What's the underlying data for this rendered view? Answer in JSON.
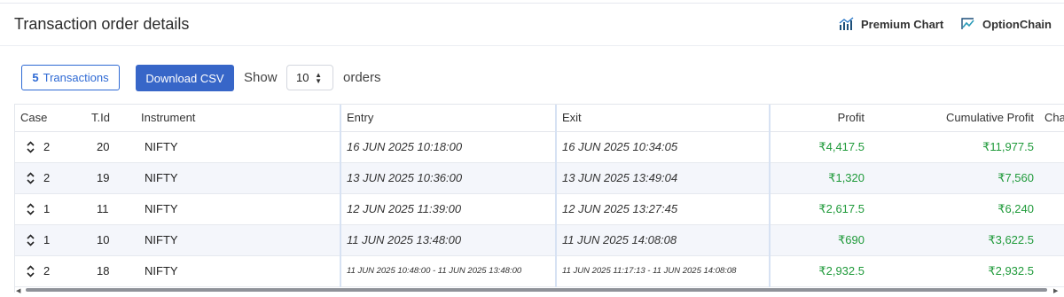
{
  "header": {
    "title": "Transaction order details",
    "premium_chart": "Premium Chart",
    "option_chain": "OptionChain"
  },
  "toolbar": {
    "count": "5",
    "count_label": "Transactions",
    "download_label": "Download CSV",
    "show_label": "Show",
    "page_size": "10",
    "orders_label": "orders"
  },
  "table": {
    "columns": {
      "case": "Case",
      "tid": "T.Id",
      "instrument": "Instrument",
      "entry": "Entry",
      "exit": "Exit",
      "profit": "Profit",
      "cumulative": "Cumulative Profit",
      "cha": "Cha"
    },
    "rows": [
      {
        "case": "2",
        "tid": "20",
        "instrument": "NIFTY",
        "entry": "16 JUN 2025 10:18:00",
        "exit": "16 JUN 2025 10:34:05",
        "profit": "₹4,417.5",
        "cumulative": "₹11,977.5"
      },
      {
        "case": "2",
        "tid": "19",
        "instrument": "NIFTY",
        "entry": "13 JUN 2025 10:36:00",
        "exit": "13 JUN 2025 13:49:04",
        "profit": "₹1,320",
        "cumulative": "₹7,560"
      },
      {
        "case": "1",
        "tid": "11",
        "instrument": "NIFTY",
        "entry": "12 JUN 2025 11:39:00",
        "exit": "12 JUN 2025 13:27:45",
        "profit": "₹2,617.5",
        "cumulative": "₹6,240"
      },
      {
        "case": "1",
        "tid": "10",
        "instrument": "NIFTY",
        "entry": "11 JUN 2025 13:48:00",
        "exit": "11 JUN 2025 14:08:08",
        "profit": "₹690",
        "cumulative": "₹3,622.5"
      },
      {
        "case": "2",
        "tid": "18",
        "instrument": "NIFTY",
        "entry": "11 JUN 2025 10:48:00 - 11 JUN 2025 13:48:00",
        "exit": "11 JUN 2025 11:17:13 - 11 JUN 2025 14:08:08",
        "profit": "₹2,932.5",
        "cumulative": "₹2,932.5"
      }
    ]
  },
  "colors": {
    "accent": "#3766c8",
    "profit_green": "#1f9a3a",
    "row_alt": "#f4f6fb"
  },
  "icons": [
    "premium-chart-icon",
    "option-chain-icon",
    "sort-icon",
    "dropdown-arrow-icon"
  ]
}
